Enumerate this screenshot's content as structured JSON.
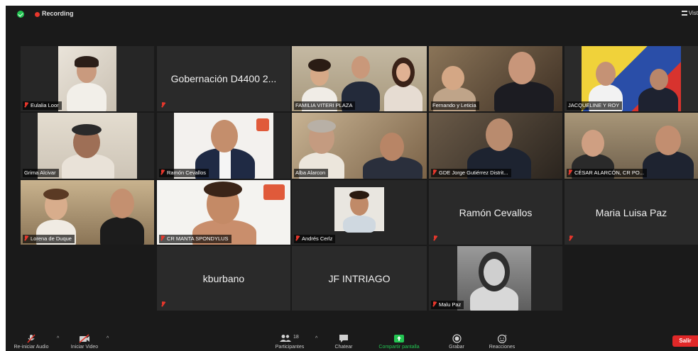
{
  "topbar": {
    "recording_label": "Recording",
    "view_label": "Vist"
  },
  "participants": [
    {
      "name": "Eulalia Loor"
    },
    {
      "name": "Gobernación D4400 2..."
    },
    {
      "name": "FAMILIA VITERI PLAZA"
    },
    {
      "name": "Fernando y Leticia"
    },
    {
      "name": "JACQUELINE Y ROY"
    },
    {
      "name": "Grima Alcivar"
    },
    {
      "name": "Ramón Cevallos"
    },
    {
      "name": "Alba Alarcon"
    },
    {
      "name": "GDE Jorge Gutiérrez Distrit..."
    },
    {
      "name": "CÉSAR ALARCÓN, CR PO..."
    },
    {
      "name": "Lorena de Duque"
    },
    {
      "name": "CR MANTA SPONDYLUS"
    },
    {
      "name": "Andrés Cerlz"
    },
    {
      "name": "Ramón Cevallos"
    },
    {
      "name": "Maria Luisa Paz"
    },
    {
      "name": "kburbano"
    },
    {
      "name": "JF INTRIAGO"
    },
    {
      "name": "Malu Paz"
    }
  ],
  "toolbar": {
    "audio_label": "Re-iniciar Audio",
    "video_label": "Iniciar Video",
    "participants_label": "Participantes",
    "participants_count": "18",
    "chat_label": "Chatear",
    "share_label": "Compartir pantalla",
    "record_label": "Grabar",
    "reactions_label": "Reacciones",
    "leave_label": "Salir"
  },
  "colors": {
    "active_speaker": "#d9f53d",
    "share_green": "#23c552",
    "leave_red": "#e02828"
  }
}
